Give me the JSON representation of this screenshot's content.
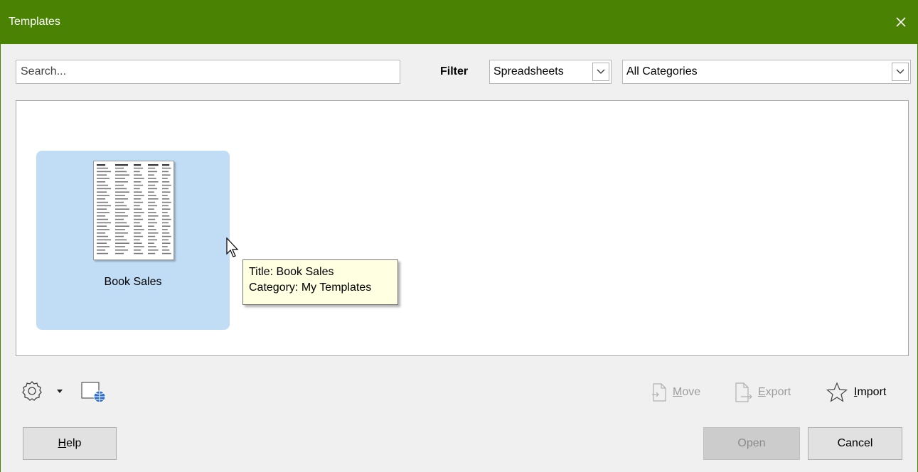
{
  "window": {
    "title": "Templates"
  },
  "search": {
    "placeholder": "Search..."
  },
  "filter": {
    "label": "Filter",
    "type_value": "Spreadsheets",
    "category_value": "All Categories"
  },
  "templates": [
    {
      "name": "Book Sales"
    }
  ],
  "tooltip": {
    "line1": "Title: Book Sales",
    "line2": "Category: My Templates"
  },
  "toolbar": {
    "move_pre": "",
    "move_key": "M",
    "move_post": "ove",
    "export_pre": "",
    "export_key": "E",
    "export_post": "xport",
    "import_pre": "",
    "import_key": "I",
    "import_post": "mport"
  },
  "buttons": {
    "help_key": "H",
    "help_rest": "elp",
    "open": "Open",
    "cancel": "Cancel"
  },
  "colors": {
    "titlebar": "#4a8204",
    "selection": "#c0ddf5",
    "tooltip_bg": "#ffffe1"
  }
}
